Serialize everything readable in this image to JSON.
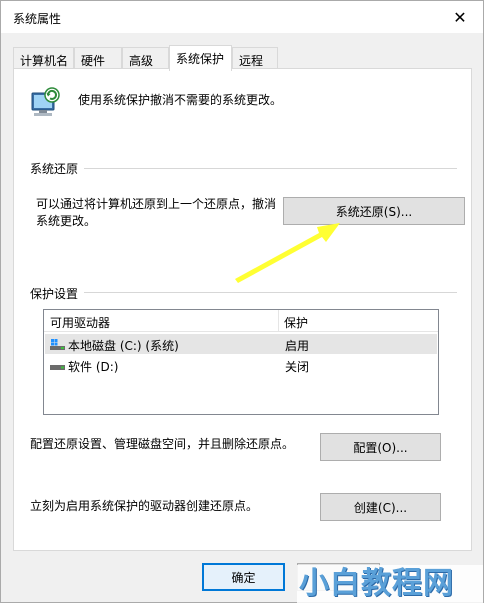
{
  "window": {
    "title": "系统属性",
    "close_glyph": "✕"
  },
  "tabs": [
    {
      "label": "计算机名"
    },
    {
      "label": "硬件"
    },
    {
      "label": "高级"
    },
    {
      "label": "系统保护",
      "active": true
    },
    {
      "label": "远程"
    }
  ],
  "intro": {
    "text": "使用系统保护撤消不需要的系统更改。",
    "icon": "computer-shield-icon"
  },
  "restore": {
    "group_label": "系统还原",
    "description": "可以通过将计算机还原到上一个还原点，撤消系统更改。",
    "button_label": "系统还原(S)..."
  },
  "protection": {
    "group_label": "保护设置",
    "columns": [
      "可用驱动器",
      "保护"
    ],
    "drives": [
      {
        "name": "本地磁盘 (C:) (系统)",
        "status": "启用",
        "icon": "system-drive-icon",
        "selected": true
      },
      {
        "name": "软件 (D:)",
        "status": "关闭",
        "icon": "drive-icon",
        "selected": false
      }
    ],
    "config_description": "配置还原设置、管理磁盘空间，并且删除还原点。",
    "config_button": "配置(O)...",
    "create_description": "立刻为启用系统保护的驱动器创建还原点。",
    "create_button": "创建(C)..."
  },
  "footer": {
    "ok_button": "确定"
  },
  "watermark": {
    "text": "小白教程网"
  },
  "colors": {
    "accent": "#0078d7",
    "annotation_arrow": "#ffff33"
  }
}
